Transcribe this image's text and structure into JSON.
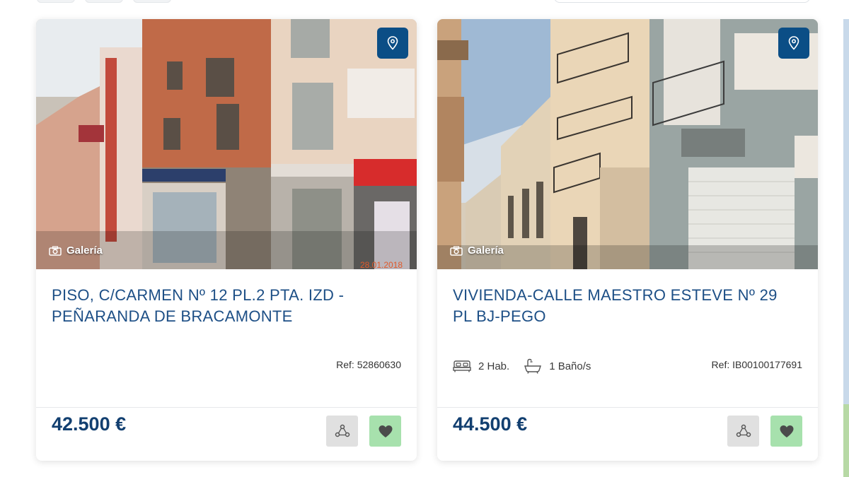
{
  "listings": [
    {
      "title": "PISO, C/CARMEN Nº 12 PL.2 PTA. IZD - PEÑARANDA DE BRACAMONTE",
      "gallery_label": "Galería",
      "ref": "Ref: 52860630",
      "price": "42.500 €",
      "photo_stamp": "28.01.2018"
    },
    {
      "title": "VIVIENDA-CALLE MAESTRO ESTEVE Nº 29 PL BJ-PEGO",
      "gallery_label": "Galería",
      "rooms": "2 Hab.",
      "baths": "1 Baño/s",
      "ref": "Ref: IB00100177691",
      "price": "44.500 €"
    }
  ],
  "colors": {
    "brand_blue": "#0b4e86",
    "title_blue": "#1d4f86",
    "price_blue": "#123f70",
    "fav_green": "#a7e1ad",
    "share_gray": "#e0e0e0"
  },
  "icons": [
    "map-pin-icon",
    "camera-icon",
    "bed-icon",
    "bath-icon",
    "share-icon",
    "heart-icon"
  ]
}
